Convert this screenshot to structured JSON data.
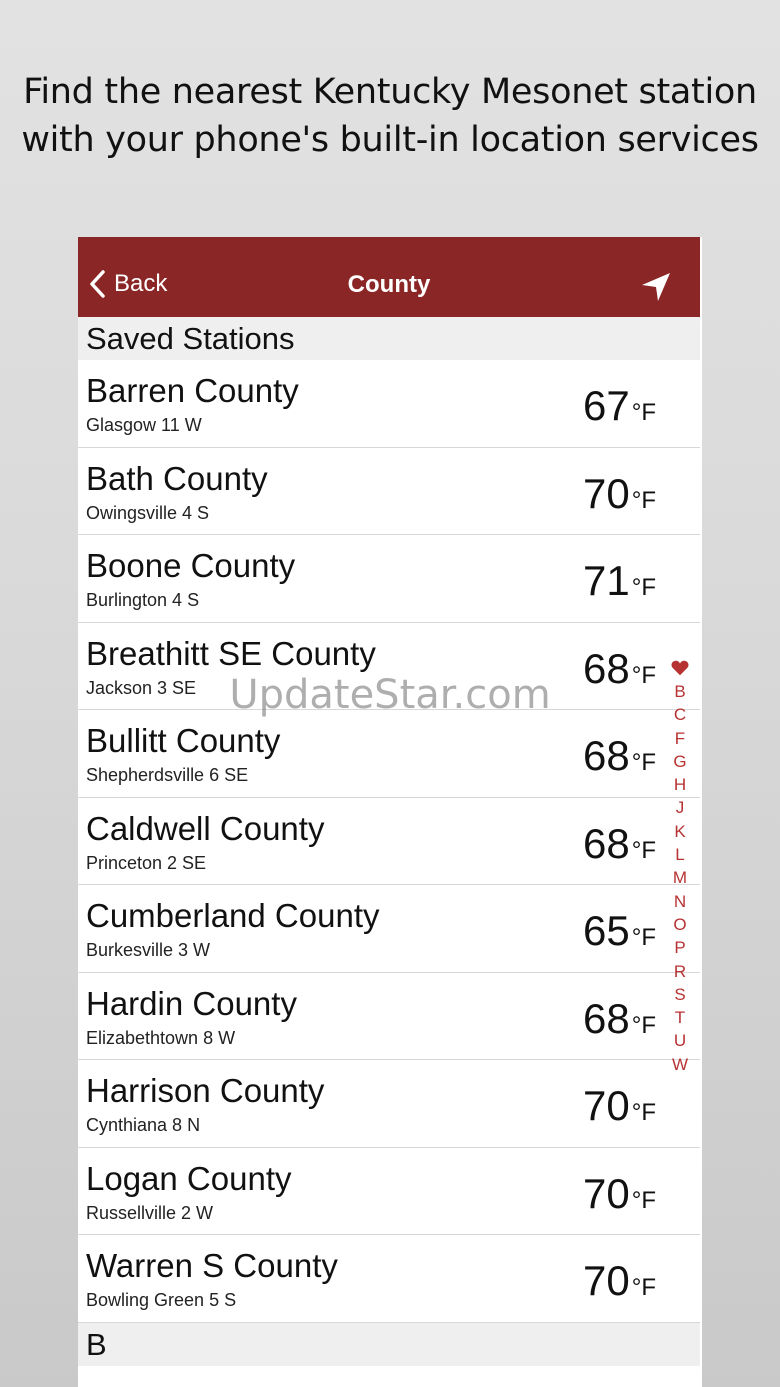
{
  "caption": {
    "line1": "Find the nearest Kentucky Mesonet station",
    "line2": "with your phone's built-in location services"
  },
  "navbar": {
    "back_label": "Back",
    "title": "County",
    "locate_icon": "location-arrow-icon"
  },
  "sections": {
    "saved": "Saved Stations",
    "next": "B"
  },
  "unit": "°F",
  "stations": [
    {
      "name": "Barren County",
      "station": "Glasgow 11 W",
      "temp": "67"
    },
    {
      "name": "Bath County",
      "station": "Owingsville 4 S",
      "temp": "70"
    },
    {
      "name": "Boone County",
      "station": "Burlington 4 S",
      "temp": "71"
    },
    {
      "name": "Breathitt SE County",
      "station": "Jackson 3 SE",
      "temp": "68"
    },
    {
      "name": "Bullitt County",
      "station": "Shepherdsville 6 SE",
      "temp": "68"
    },
    {
      "name": "Caldwell County",
      "station": "Princeton 2 SE",
      "temp": "68"
    },
    {
      "name": "Cumberland County",
      "station": "Burkesville 3 W",
      "temp": "65"
    },
    {
      "name": "Hardin County",
      "station": "Elizabethtown 8 W",
      "temp": "68"
    },
    {
      "name": "Harrison County",
      "station": "Cynthiana 8 N",
      "temp": "70"
    },
    {
      "name": "Logan County",
      "station": "Russellville 2 W",
      "temp": "70"
    },
    {
      "name": "Warren S County",
      "station": "Bowling Green 5 S",
      "temp": "70"
    }
  ],
  "index_letters": [
    "B",
    "C",
    "F",
    "G",
    "H",
    "J",
    "K",
    "L",
    "M",
    "N",
    "O",
    "P",
    "R",
    "S",
    "T",
    "U",
    "W"
  ],
  "index_heart_icon": "heart-icon",
  "colors": {
    "accent": "#8b2626",
    "index": "#b73232"
  },
  "watermark": "UpdateStar.com"
}
